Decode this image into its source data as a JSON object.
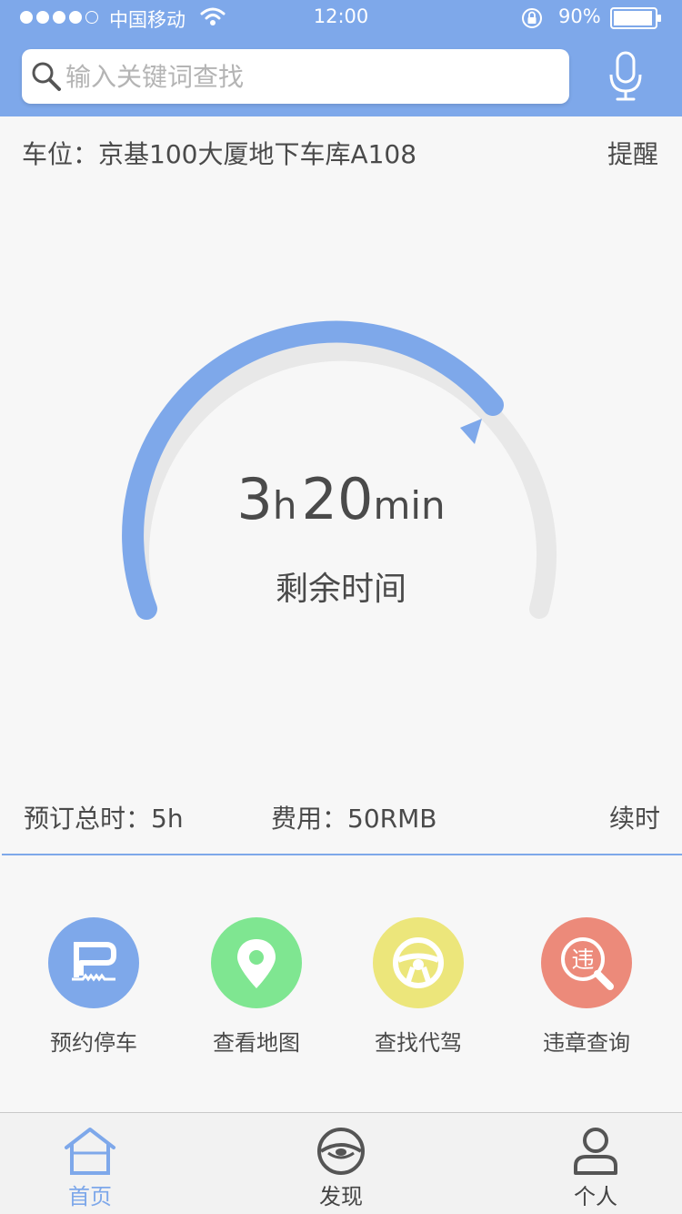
{
  "status_bar": {
    "carrier": "中国移动",
    "time": "12:00",
    "battery": "90%",
    "signal_bars_filled": 4,
    "signal_bars_total": 5
  },
  "search": {
    "placeholder": "输入关键词查找"
  },
  "parking": {
    "location": "车位：京基100大厦地下车库A108",
    "remind": "提醒"
  },
  "timer": {
    "hours": "3",
    "hours_unit": "h",
    "minutes": "20",
    "minutes_unit": "min",
    "label": "剩余时间",
    "remaining_fraction": 0.667
  },
  "booking": {
    "total": "预订总时：5h",
    "fee": "费用：50RMB",
    "renew": "续时"
  },
  "shortcuts": [
    {
      "label": "预约停车",
      "icon": "parking-ticket-icon",
      "color": "#7ea8ea"
    },
    {
      "label": "查看地图",
      "icon": "map-pin-icon",
      "color": "#7fe691"
    },
    {
      "label": "查找代驾",
      "icon": "steering-wheel-icon",
      "color": "#ece67b"
    },
    {
      "label": "违章查询",
      "icon": "violation-search-icon",
      "color": "#ec8a7a",
      "glyph": "违"
    }
  ],
  "tabs": [
    {
      "label": "首页",
      "icon": "home-icon",
      "active": true
    },
    {
      "label": "发现",
      "icon": "eye-icon",
      "active": false
    },
    {
      "label": "个人",
      "icon": "user-icon",
      "active": false
    }
  ],
  "colors": {
    "accent": "#7ea8ea",
    "track": "#e8e8e8",
    "text": "#4a4a4a",
    "inactive_tab": "#555555"
  }
}
